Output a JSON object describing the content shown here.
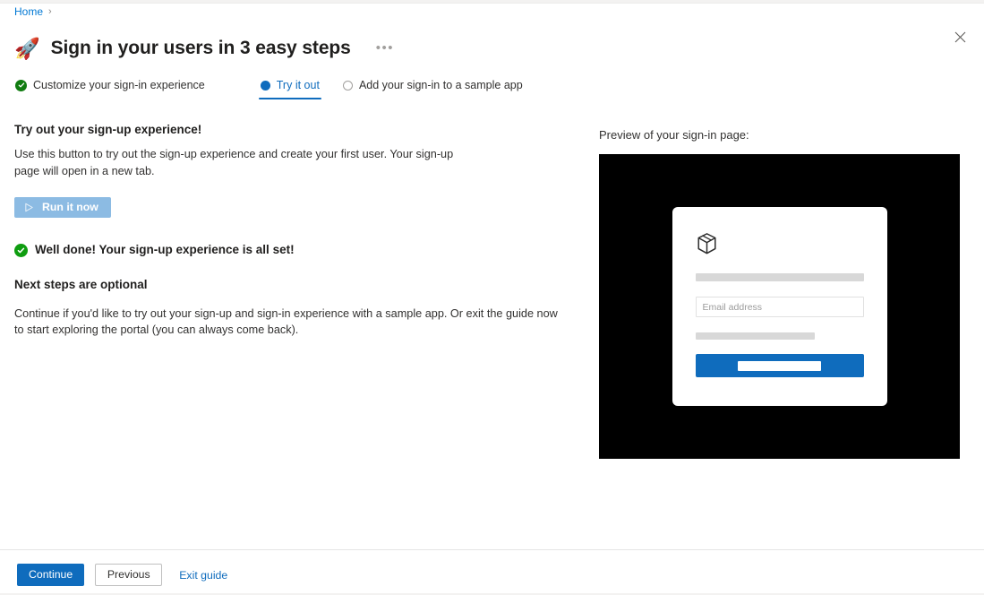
{
  "breadcrumb": {
    "items": [
      "Home"
    ],
    "separator": "›"
  },
  "header": {
    "icon": "rocket-icon",
    "icon_glyph": "🚀",
    "title": "Sign in your users in 3 easy steps",
    "more_label": "•••",
    "close_label": "Close"
  },
  "steps": [
    {
      "label": "Customize your sign-in experience",
      "state": "completed",
      "icon": "check-circle-icon"
    },
    {
      "label": "Try it out",
      "state": "current",
      "icon": "filled-circle-icon"
    },
    {
      "label": "Add your sign-in to a sample app",
      "state": "pending",
      "icon": "empty-circle-icon"
    }
  ],
  "main": {
    "section_heading": "Try out your sign-up experience!",
    "section_body": "Use this button to try out the sign-up experience and create your first user. Your sign-up page will open in a new tab.",
    "run_button_label": "Run it now",
    "run_button_icon": "play-triangle-icon",
    "run_button_color": "#8cbbe3",
    "success_message": "Well done! Your sign-up experience is all set!",
    "success_color": "#0f9d10",
    "next_steps_heading": "Next steps are optional",
    "next_steps_body": "Continue if you'd like to try out your sign-up and sign-in experience with a sample app. Or exit the guide now to start exploring the portal (you can always come back)."
  },
  "preview": {
    "label": "Preview of your sign-in page:",
    "background_color": "#000000",
    "card": {
      "logo_icon": "cube-box-icon",
      "email_placeholder": "Email address",
      "submit_color": "#0f6cbd"
    }
  },
  "footer": {
    "continue_label": "Continue",
    "previous_label": "Previous",
    "exit_label": "Exit guide",
    "primary_color": "#0f6cbd",
    "link_color": "#0f6cbd"
  }
}
